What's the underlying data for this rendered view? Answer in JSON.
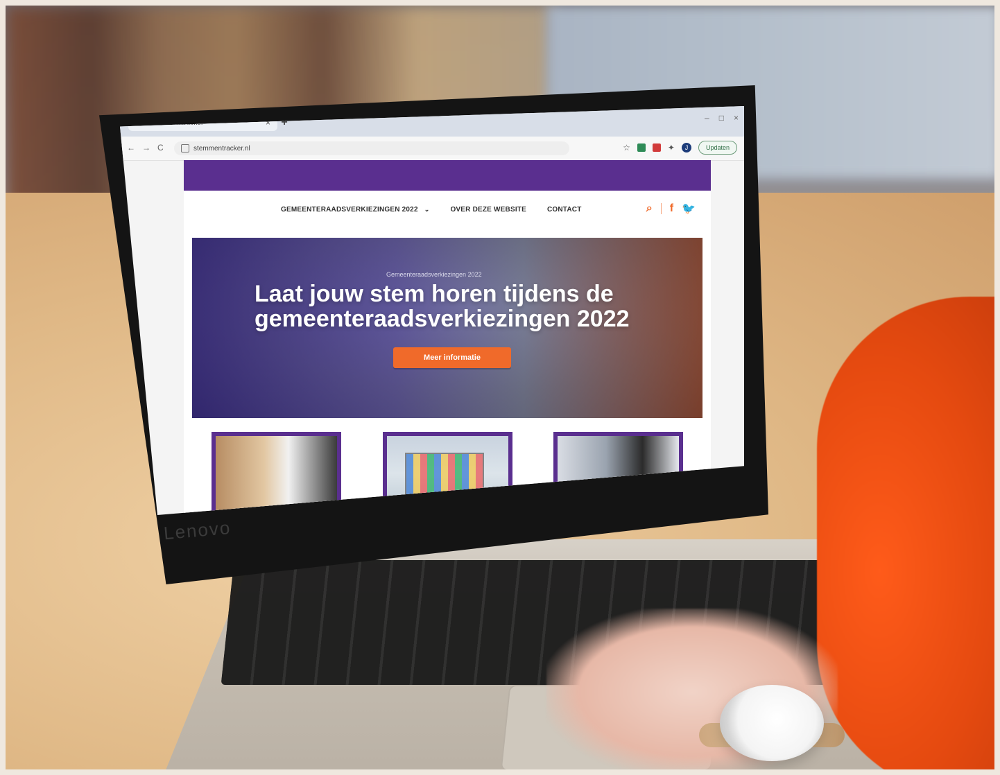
{
  "browser": {
    "tab": {
      "title": "StemmenTracker",
      "logo_letter": "m",
      "close": "×"
    },
    "new_tab": "+",
    "window_controls": [
      "–",
      "□",
      "×"
    ],
    "nav": {
      "back": "←",
      "forward": "→",
      "reload": "C"
    },
    "address": {
      "url": "stemmentracker.nl"
    },
    "right": {
      "avatar_letter": "J",
      "update_label": "Updaten"
    }
  },
  "site": {
    "menu": [
      {
        "label": "GEMEENTERAADSVERKIEZINGEN 2022",
        "has_dropdown": true
      },
      {
        "label": "OVER DEZE WEBSITE",
        "has_dropdown": false
      },
      {
        "label": "CONTACT",
        "has_dropdown": false
      }
    ],
    "icons": {
      "search": "search-icon",
      "facebook": "facebook-icon",
      "twitter": "twitter-icon"
    },
    "hero": {
      "kicker": "Gemeenteraadsverkiezingen 2022",
      "headline": "Laat jouw stem horen tijdens de gemeenteraadsverkiezingen 2022",
      "cta": "Meer informatie"
    }
  },
  "device": {
    "brand": "Lenovo"
  },
  "colors": {
    "purple": "#5a2f8f",
    "orange": "#f06a2a",
    "frame": "#efe8df"
  }
}
